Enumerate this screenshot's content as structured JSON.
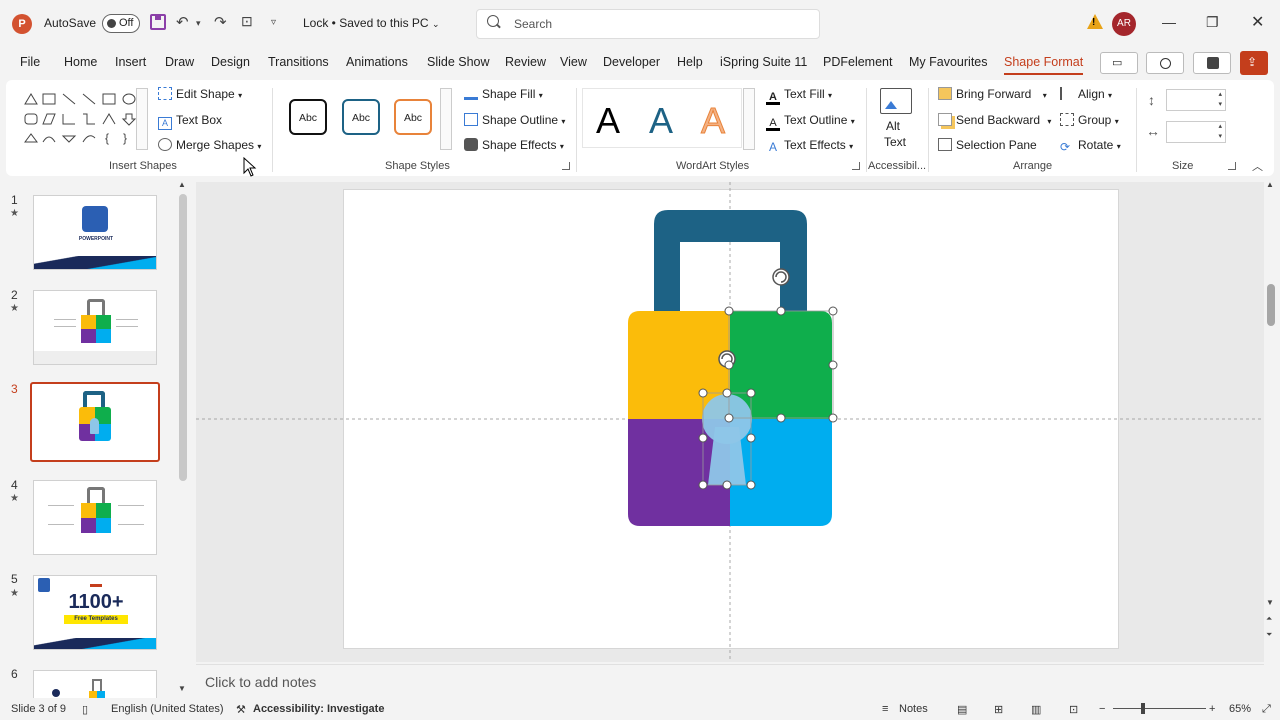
{
  "titlebar": {
    "autosave_label": "AutoSave",
    "autosave_state": "Off",
    "document_title": "Lock • Saved to this PC",
    "search_placeholder": "Search",
    "user_initials": "AR",
    "app_icon_letter": "P"
  },
  "menu": {
    "tabs": [
      "File",
      "Home",
      "Insert",
      "Draw",
      "Design",
      "Transitions",
      "Animations",
      "Slide Show",
      "Review",
      "View",
      "Developer",
      "Help",
      "iSpring Suite 11",
      "PDFelement",
      "My Favourites",
      "Shape Format"
    ],
    "active_tab": "Shape Format"
  },
  "ribbon": {
    "insert_shapes": {
      "group_label": "Insert Shapes",
      "edit_shape": "Edit Shape",
      "text_box": "Text Box",
      "merge_shapes": "Merge Shapes"
    },
    "shape_styles": {
      "group_label": "Shape Styles",
      "preview_text": "Abc",
      "shape_fill": "Shape Fill",
      "shape_outline": "Shape Outline",
      "shape_effects": "Shape Effects"
    },
    "wordart_styles": {
      "group_label": "WordArt Styles",
      "letter": "A",
      "text_fill": "Text Fill",
      "text_outline": "Text Outline",
      "text_effects": "Text Effects"
    },
    "accessibility": {
      "group_label": "Accessibil...",
      "alt_text_line1": "Alt",
      "alt_text_line2": "Text"
    },
    "arrange": {
      "group_label": "Arrange",
      "bring_forward": "Bring Forward",
      "send_backward": "Send Backward",
      "selection_pane": "Selection Pane",
      "align": "Align",
      "group": "Group",
      "rotate": "Rotate"
    },
    "size": {
      "group_label": "Size",
      "height_value": "",
      "width_value": ""
    }
  },
  "thumbnails": {
    "numbers": [
      "1",
      "2",
      "3",
      "4",
      "5",
      "6"
    ],
    "selected_index": 3,
    "slide1_title": "POWERPOINT",
    "slide5_big": "1100+",
    "slide5_sub": "Free Templates"
  },
  "notes": {
    "placeholder": "Click to add notes"
  },
  "statusbar": {
    "slide_info": "Slide 3 of 9",
    "language": "English (United States)",
    "accessibility": "Accessibility: Investigate",
    "notes_label": "Notes",
    "zoom_minus": "−",
    "zoom_plus": "+",
    "zoom_level": "65%"
  },
  "colors": {
    "accent": "#c43e1c",
    "lock_shackle": "#1d6285",
    "yellow": "#fbbc0a",
    "green": "#0fae4c",
    "purple": "#7030a0",
    "blue": "#00adef",
    "keyhole": "#8ec6e8"
  }
}
